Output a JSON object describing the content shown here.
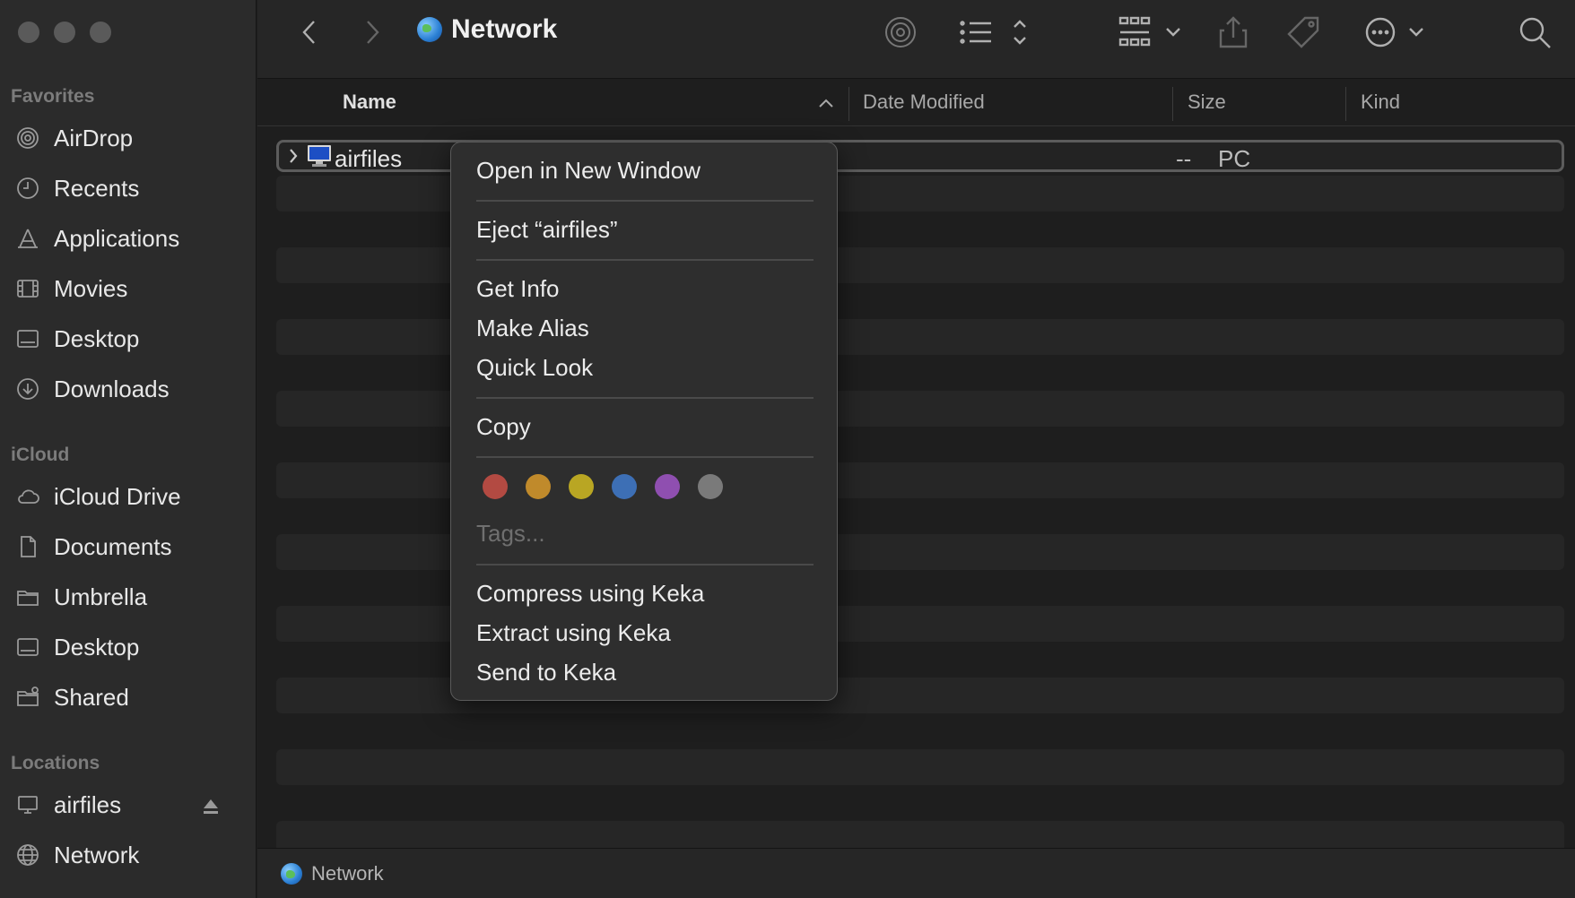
{
  "window": {
    "title": "Network"
  },
  "sidebar": {
    "sections": [
      {
        "title": "Favorites",
        "items": [
          {
            "label": "AirDrop",
            "icon": "airdrop-icon"
          },
          {
            "label": "Recents",
            "icon": "clock-icon"
          },
          {
            "label": "Applications",
            "icon": "applications-icon"
          },
          {
            "label": "Movies",
            "icon": "film-icon"
          },
          {
            "label": "Desktop",
            "icon": "desktop-icon"
          },
          {
            "label": "Downloads",
            "icon": "download-icon"
          }
        ]
      },
      {
        "title": "iCloud",
        "items": [
          {
            "label": "iCloud Drive",
            "icon": "cloud-icon"
          },
          {
            "label": "Documents",
            "icon": "document-icon"
          },
          {
            "label": "Umbrella",
            "icon": "folder-icon"
          },
          {
            "label": "Desktop",
            "icon": "desktop-icon"
          },
          {
            "label": "Shared",
            "icon": "shared-folder-icon"
          }
        ]
      },
      {
        "title": "Locations",
        "items": [
          {
            "label": "airfiles",
            "icon": "computer-icon"
          },
          {
            "label": "Network",
            "icon": "globe-icon"
          }
        ]
      }
    ]
  },
  "columns": {
    "name": "Name",
    "date_modified": "Date Modified",
    "size": "Size",
    "kind": "Kind"
  },
  "rows": [
    {
      "name": "airfiles",
      "date_modified": "--",
      "size": "--",
      "kind": "PC"
    }
  ],
  "status_bar": {
    "location": "Network"
  },
  "context_menu": {
    "groups": [
      [
        "Open in New Window"
      ],
      [
        "Eject “airfiles”"
      ],
      [
        "Get Info",
        "Make Alias",
        "Quick Look"
      ],
      [
        "Copy"
      ]
    ],
    "tag_colors": [
      "#b34a42",
      "#c08a2b",
      "#b9a623",
      "#3d6fb5",
      "#8f4fb0",
      "#7a7a7a"
    ],
    "tags_placeholder": "Tags...",
    "keka_items": [
      "Compress using Keka",
      "Extract using Keka",
      "Send to Keka"
    ]
  }
}
